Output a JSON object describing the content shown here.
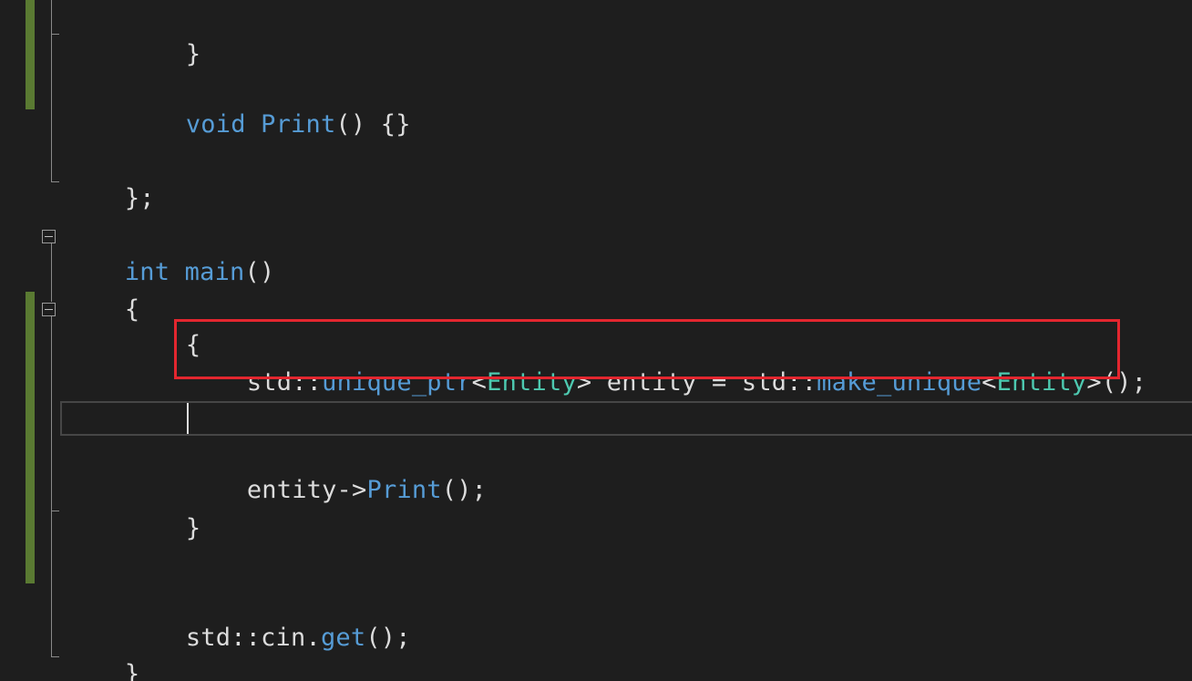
{
  "editor": {
    "lines": {
      "close_brace_method": "}",
      "print_kw": "void",
      "print_name": "Print",
      "print_rest": "() {}",
      "class_end": "};",
      "main_kw": "int",
      "main_name": "main",
      "main_rest": "()",
      "main_open": "{",
      "scope_open": "{",
      "l1_std1": "std::",
      "l1_unique_ptr": "unique_ptr",
      "l1_lt1": "<",
      "l1_entity1": "Entity",
      "l1_mid": "> entity = std::",
      "l1_make_unique": "make_unique",
      "l1_lt2": "<",
      "l1_entity2": "Entity",
      "l1_end": ">();",
      "call_obj": "entity->",
      "call_name": "Print",
      "call_rest": "();",
      "scope_close": "}",
      "cin_std": "std::cin.",
      "cin_get": "get",
      "cin_rest": "();",
      "main_close": "}"
    },
    "colors": {
      "background": "#1e1e1e",
      "text": "#dcdcdc",
      "keyword": "#569cd6",
      "type": "#4ec9b0",
      "highlight_border": "#e3262f",
      "change_bar": "#5a7a32"
    }
  }
}
